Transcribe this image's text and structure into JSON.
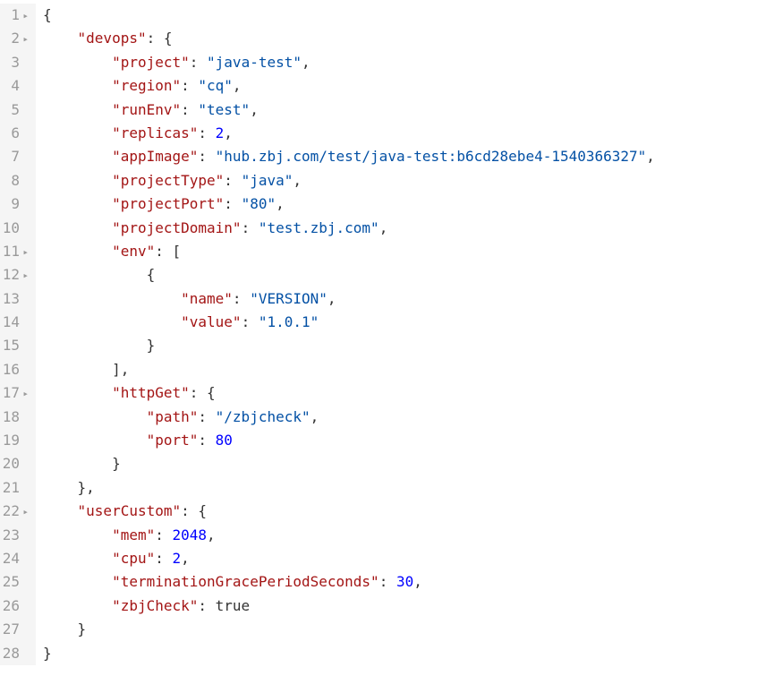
{
  "lines": [
    {
      "num": "1",
      "fold": "▸",
      "indent": 0,
      "tokens": [
        {
          "t": "{",
          "c": "p"
        }
      ]
    },
    {
      "num": "2",
      "fold": "▸",
      "indent": 1,
      "tokens": [
        {
          "t": "\"devops\"",
          "c": "k"
        },
        {
          "t": ": {",
          "c": "p"
        }
      ]
    },
    {
      "num": "3",
      "fold": "",
      "indent": 2,
      "tokens": [
        {
          "t": "\"project\"",
          "c": "k"
        },
        {
          "t": ": ",
          "c": "p"
        },
        {
          "t": "\"java-test\"",
          "c": "s"
        },
        {
          "t": ",",
          "c": "p"
        }
      ]
    },
    {
      "num": "4",
      "fold": "",
      "indent": 2,
      "tokens": [
        {
          "t": "\"region\"",
          "c": "k"
        },
        {
          "t": ": ",
          "c": "p"
        },
        {
          "t": "\"cq\"",
          "c": "s"
        },
        {
          "t": ",",
          "c": "p"
        }
      ]
    },
    {
      "num": "5",
      "fold": "",
      "indent": 2,
      "tokens": [
        {
          "t": "\"runEnv\"",
          "c": "k"
        },
        {
          "t": ": ",
          "c": "p"
        },
        {
          "t": "\"test\"",
          "c": "s"
        },
        {
          "t": ",",
          "c": "p"
        }
      ]
    },
    {
      "num": "6",
      "fold": "",
      "indent": 2,
      "tokens": [
        {
          "t": "\"replicas\"",
          "c": "k"
        },
        {
          "t": ": ",
          "c": "p"
        },
        {
          "t": "2",
          "c": "n"
        },
        {
          "t": ",",
          "c": "p"
        }
      ]
    },
    {
      "num": "7",
      "fold": "",
      "indent": 2,
      "tokens": [
        {
          "t": "\"appImage\"",
          "c": "k"
        },
        {
          "t": ": ",
          "c": "p"
        },
        {
          "t": "\"hub.zbj.com/test/java-test:b6cd28ebe4-1540366327\"",
          "c": "s"
        },
        {
          "t": ",",
          "c": "p"
        }
      ]
    },
    {
      "num": "8",
      "fold": "",
      "indent": 2,
      "tokens": [
        {
          "t": "\"projectType\"",
          "c": "k"
        },
        {
          "t": ": ",
          "c": "p"
        },
        {
          "t": "\"java\"",
          "c": "s"
        },
        {
          "t": ",",
          "c": "p"
        }
      ]
    },
    {
      "num": "9",
      "fold": "",
      "indent": 2,
      "tokens": [
        {
          "t": "\"projectPort\"",
          "c": "k"
        },
        {
          "t": ": ",
          "c": "p"
        },
        {
          "t": "\"80\"",
          "c": "s"
        },
        {
          "t": ",",
          "c": "p"
        }
      ]
    },
    {
      "num": "10",
      "fold": "",
      "indent": 2,
      "tokens": [
        {
          "t": "\"projectDomain\"",
          "c": "k"
        },
        {
          "t": ": ",
          "c": "p"
        },
        {
          "t": "\"test.zbj.com\"",
          "c": "s"
        },
        {
          "t": ",",
          "c": "p"
        }
      ]
    },
    {
      "num": "11",
      "fold": "▸",
      "indent": 2,
      "tokens": [
        {
          "t": "\"env\"",
          "c": "k"
        },
        {
          "t": ": [",
          "c": "p"
        }
      ]
    },
    {
      "num": "12",
      "fold": "▸",
      "indent": 3,
      "tokens": [
        {
          "t": "{",
          "c": "p"
        }
      ]
    },
    {
      "num": "13",
      "fold": "",
      "indent": 4,
      "tokens": [
        {
          "t": "\"name\"",
          "c": "k"
        },
        {
          "t": ": ",
          "c": "p"
        },
        {
          "t": "\"VERSION\"",
          "c": "s"
        },
        {
          "t": ",",
          "c": "p"
        }
      ]
    },
    {
      "num": "14",
      "fold": "",
      "indent": 4,
      "tokens": [
        {
          "t": "\"value\"",
          "c": "k"
        },
        {
          "t": ": ",
          "c": "p"
        },
        {
          "t": "\"1.0.1\"",
          "c": "s"
        }
      ]
    },
    {
      "num": "15",
      "fold": "",
      "indent": 3,
      "tokens": [
        {
          "t": "}",
          "c": "p"
        }
      ]
    },
    {
      "num": "16",
      "fold": "",
      "indent": 2,
      "tokens": [
        {
          "t": "],",
          "c": "p"
        }
      ]
    },
    {
      "num": "17",
      "fold": "▸",
      "indent": 2,
      "tokens": [
        {
          "t": "\"httpGet\"",
          "c": "k"
        },
        {
          "t": ": {",
          "c": "p"
        }
      ]
    },
    {
      "num": "18",
      "fold": "",
      "indent": 3,
      "tokens": [
        {
          "t": "\"path\"",
          "c": "k"
        },
        {
          "t": ": ",
          "c": "p"
        },
        {
          "t": "\"/zbjcheck\"",
          "c": "s"
        },
        {
          "t": ",",
          "c": "p"
        }
      ]
    },
    {
      "num": "19",
      "fold": "",
      "indent": 3,
      "tokens": [
        {
          "t": "\"port\"",
          "c": "k"
        },
        {
          "t": ": ",
          "c": "p"
        },
        {
          "t": "80",
          "c": "n"
        }
      ]
    },
    {
      "num": "20",
      "fold": "",
      "indent": 2,
      "tokens": [
        {
          "t": "}",
          "c": "p"
        }
      ]
    },
    {
      "num": "21",
      "fold": "",
      "indent": 1,
      "tokens": [
        {
          "t": "},",
          "c": "p"
        }
      ]
    },
    {
      "num": "22",
      "fold": "▸",
      "indent": 1,
      "tokens": [
        {
          "t": "\"userCustom\"",
          "c": "k"
        },
        {
          "t": ": {",
          "c": "p"
        }
      ]
    },
    {
      "num": "23",
      "fold": "",
      "indent": 2,
      "tokens": [
        {
          "t": "\"mem\"",
          "c": "k"
        },
        {
          "t": ": ",
          "c": "p"
        },
        {
          "t": "2048",
          "c": "n"
        },
        {
          "t": ",",
          "c": "p"
        }
      ]
    },
    {
      "num": "24",
      "fold": "",
      "indent": 2,
      "tokens": [
        {
          "t": "\"cpu\"",
          "c": "k"
        },
        {
          "t": ": ",
          "c": "p"
        },
        {
          "t": "2",
          "c": "n"
        },
        {
          "t": ",",
          "c": "p"
        }
      ]
    },
    {
      "num": "25",
      "fold": "",
      "indent": 2,
      "tokens": [
        {
          "t": "\"terminationGracePeriodSeconds\"",
          "c": "k"
        },
        {
          "t": ": ",
          "c": "p"
        },
        {
          "t": "30",
          "c": "n"
        },
        {
          "t": ",",
          "c": "p"
        }
      ]
    },
    {
      "num": "26",
      "fold": "",
      "indent": 2,
      "tokens": [
        {
          "t": "\"zbjCheck\"",
          "c": "k"
        },
        {
          "t": ": ",
          "c": "p"
        },
        {
          "t": "true",
          "c": "b"
        }
      ]
    },
    {
      "num": "27",
      "fold": "",
      "indent": 1,
      "tokens": [
        {
          "t": "}",
          "c": "p"
        }
      ]
    },
    {
      "num": "28",
      "fold": "",
      "indent": 0,
      "tokens": [
        {
          "t": "}",
          "c": "p"
        }
      ]
    }
  ],
  "indentUnit": "    "
}
